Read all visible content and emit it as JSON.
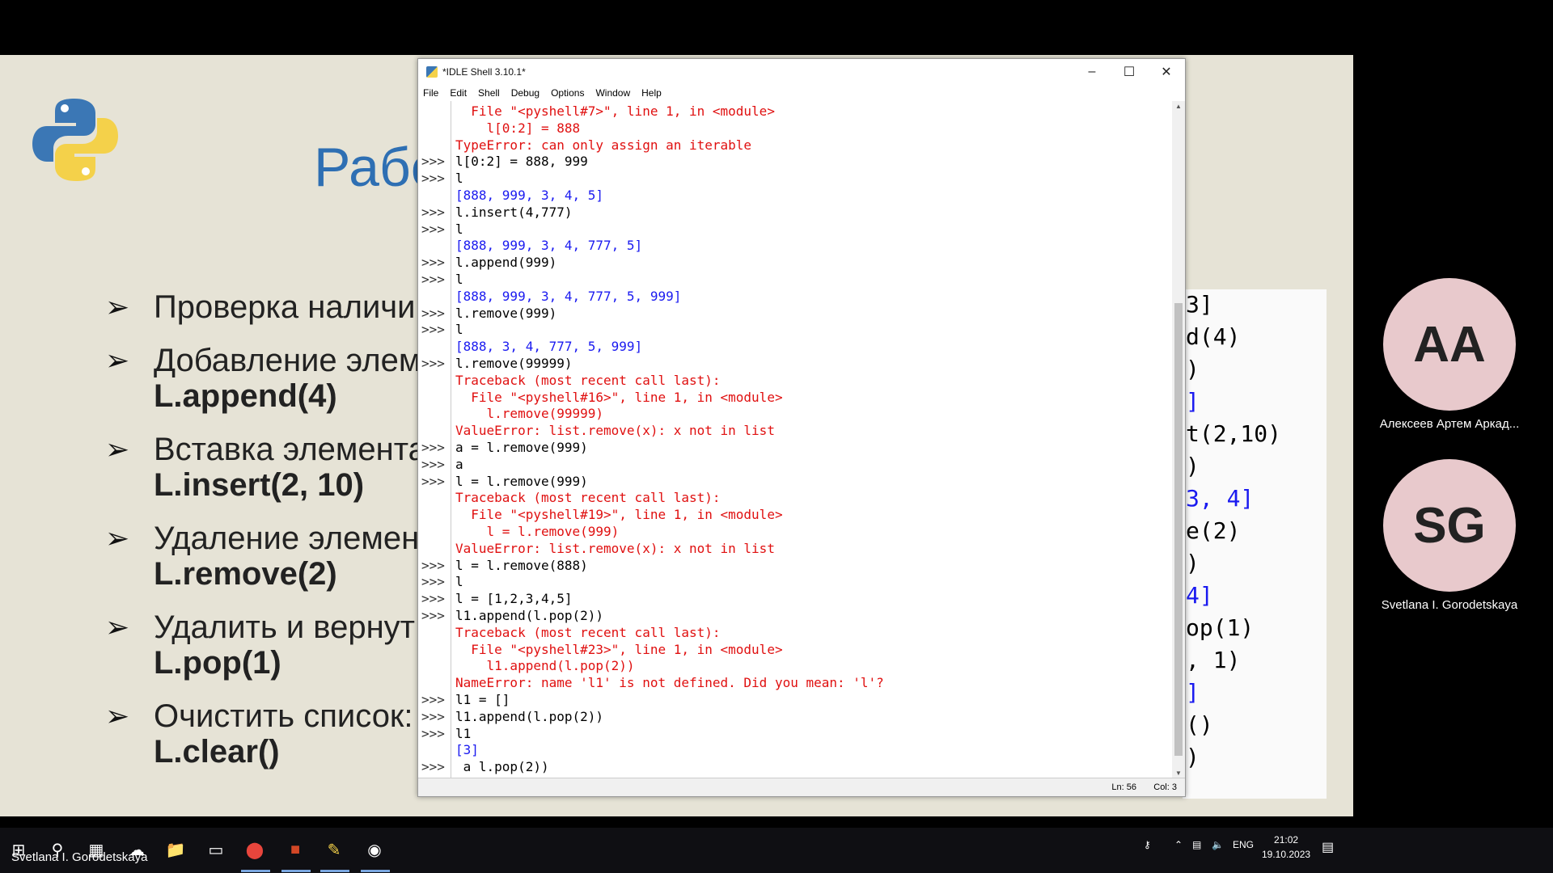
{
  "slide": {
    "title": "Рабо",
    "bullets": [
      {
        "text": "Проверка наличи",
        "code": ""
      },
      {
        "text": "Добавление элем",
        "code": "L.append(4)"
      },
      {
        "text": "Вставка элемента",
        "code": "L.insert(2, 10)"
      },
      {
        "text": "Удаление элемен",
        "code": "L.remove(2)"
      },
      {
        "text": "Удалить и вернут",
        "code": "L.pop(1)"
      },
      {
        "text": "Очистить список:",
        "code": "L.clear()"
      }
    ],
    "code_fragments": [
      "3]",
      "d(4)",
      ")",
      "]",
      "t(2,10)",
      ")",
      "3, 4]",
      "e(2)",
      ")",
      "4]",
      "op(1)",
      ", 1)",
      "]",
      "()",
      ")"
    ]
  },
  "window": {
    "title": "*IDLE Shell 3.10.1*",
    "menu": [
      "File",
      "Edit",
      "Shell",
      "Debug",
      "Options",
      "Window",
      "Help"
    ],
    "status": {
      "ln": "Ln: 56",
      "col": "Col: 3"
    }
  },
  "shell_lines": [
    {
      "p": "",
      "t": "  File \"<pyshell#7>\", line 1, in <module>",
      "c": "err"
    },
    {
      "p": "",
      "t": "    l[0:2] = 888",
      "c": "err"
    },
    {
      "p": "",
      "t": "TypeError: can only assign an iterable",
      "c": "err"
    },
    {
      "p": ">>>",
      "t": "l[0:2] = 888, 999",
      "c": "stdin"
    },
    {
      "p": ">>>",
      "t": "l",
      "c": "stdin"
    },
    {
      "p": "",
      "t": "[888, 999, 3, 4, 5]",
      "c": "stdout"
    },
    {
      "p": ">>>",
      "t": "l.insert(4,777)",
      "c": "stdin"
    },
    {
      "p": ">>>",
      "t": "l",
      "c": "stdin"
    },
    {
      "p": "",
      "t": "[888, 999, 3, 4, 777, 5]",
      "c": "stdout"
    },
    {
      "p": ">>>",
      "t": "l.append(999)",
      "c": "stdin"
    },
    {
      "p": ">>>",
      "t": "l",
      "c": "stdin"
    },
    {
      "p": "",
      "t": "[888, 999, 3, 4, 777, 5, 999]",
      "c": "stdout"
    },
    {
      "p": ">>>",
      "t": "l.remove(999)",
      "c": "stdin"
    },
    {
      "p": ">>>",
      "t": "l",
      "c": "stdin"
    },
    {
      "p": "",
      "t": "[888, 3, 4, 777, 5, 999]",
      "c": "stdout"
    },
    {
      "p": ">>>",
      "t": "l.remove(99999)",
      "c": "stdin"
    },
    {
      "p": "",
      "t": "Traceback (most recent call last):",
      "c": "err"
    },
    {
      "p": "",
      "t": "  File \"<pyshell#16>\", line 1, in <module>",
      "c": "err"
    },
    {
      "p": "",
      "t": "    l.remove(99999)",
      "c": "err"
    },
    {
      "p": "",
      "t": "ValueError: list.remove(x): x not in list",
      "c": "err"
    },
    {
      "p": ">>>",
      "t": "a = l.remove(999)",
      "c": "stdin"
    },
    {
      "p": ">>>",
      "t": "a",
      "c": "stdin"
    },
    {
      "p": ">>>",
      "t": "l = l.remove(999)",
      "c": "stdin"
    },
    {
      "p": "",
      "t": "Traceback (most recent call last):",
      "c": "err"
    },
    {
      "p": "",
      "t": "  File \"<pyshell#19>\", line 1, in <module>",
      "c": "err"
    },
    {
      "p": "",
      "t": "    l = l.remove(999)",
      "c": "err"
    },
    {
      "p": "",
      "t": "ValueError: list.remove(x): x not in list",
      "c": "err"
    },
    {
      "p": ">>>",
      "t": "l = l.remove(888)",
      "c": "stdin"
    },
    {
      "p": ">>>",
      "t": "l",
      "c": "stdin"
    },
    {
      "p": ">>>",
      "t": "l = [1,2,3,4,5]",
      "c": "stdin"
    },
    {
      "p": ">>>",
      "t": "l1.append(l.pop(2))",
      "c": "stdin"
    },
    {
      "p": "",
      "t": "Traceback (most recent call last):",
      "c": "err"
    },
    {
      "p": "",
      "t": "  File \"<pyshell#23>\", line 1, in <module>",
      "c": "err"
    },
    {
      "p": "",
      "t": "    l1.append(l.pop(2))",
      "c": "err"
    },
    {
      "p": "",
      "t": "NameError: name 'l1' is not defined. Did you mean: 'l'?",
      "c": "err"
    },
    {
      "p": ">>>",
      "t": "l1 = []",
      "c": "stdin"
    },
    {
      "p": ">>>",
      "t": "l1.append(l.pop(2))",
      "c": "stdin"
    },
    {
      "p": ">>>",
      "t": "l1",
      "c": "stdin"
    },
    {
      "p": "",
      "t": "[3]",
      "c": "stdout"
    },
    {
      "p": ">>>",
      "t": " a l.pop(2))",
      "c": "stdin"
    }
  ],
  "participants": [
    {
      "initials": "AA",
      "name": "Алексеев Артем Аркад..."
    },
    {
      "initials": "SG",
      "name": "Svetlana I. Gorodetskaya"
    }
  ],
  "taskbar": {
    "user": "Svetlana I. Gorodetskaya",
    "lang": "ENG",
    "time": "21:02",
    "date": "19.10.2023"
  },
  "colors": {
    "stdin": "#000000",
    "stdout": "#1a1af0",
    "err": "#e01010"
  }
}
